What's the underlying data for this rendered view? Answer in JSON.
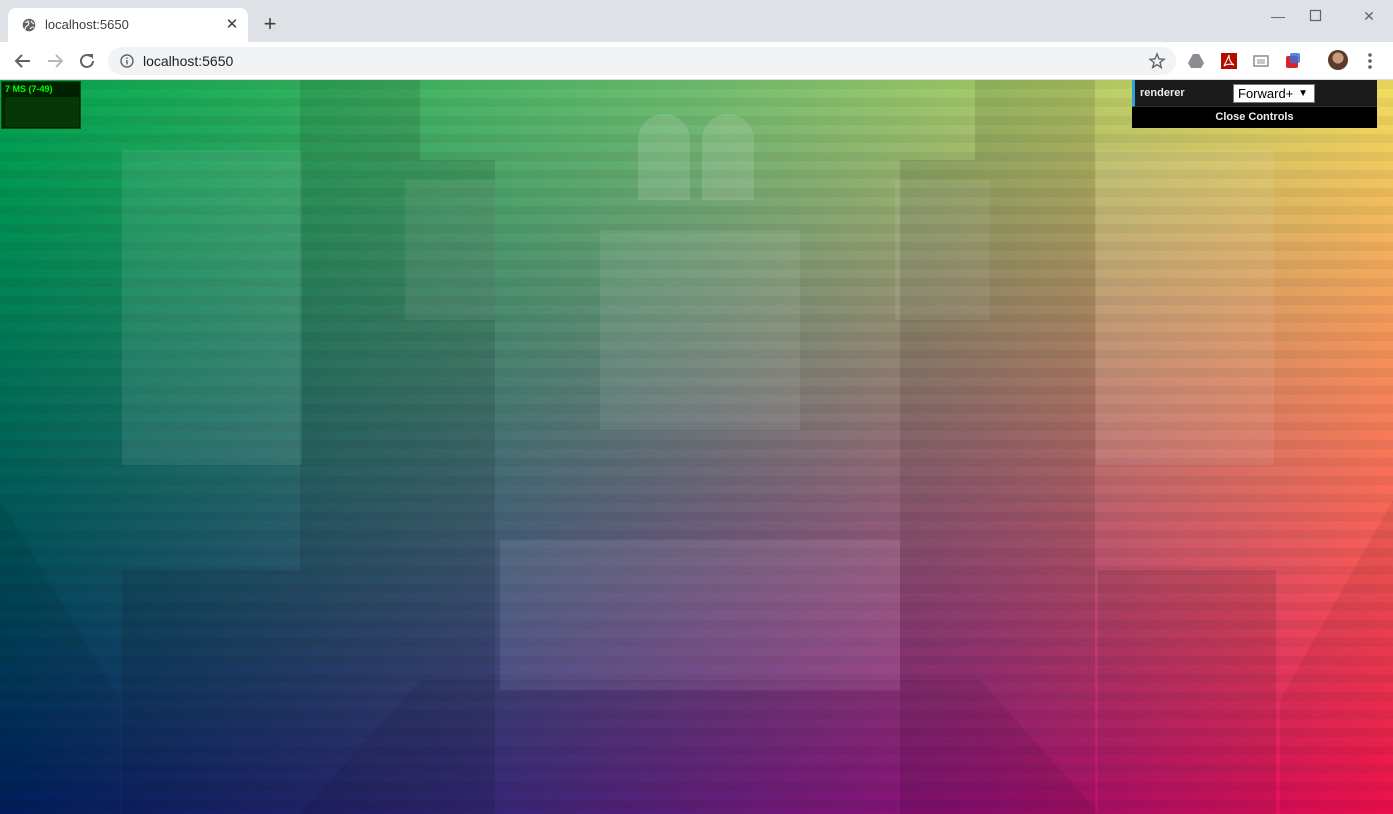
{
  "browser": {
    "tab_title": "localhost:5650",
    "url": "localhost:5650"
  },
  "stats": {
    "label": "7 MS (7-49)"
  },
  "controls": {
    "renderer_label": "renderer",
    "renderer_value": "Forward+",
    "close_label": "Close Controls"
  }
}
